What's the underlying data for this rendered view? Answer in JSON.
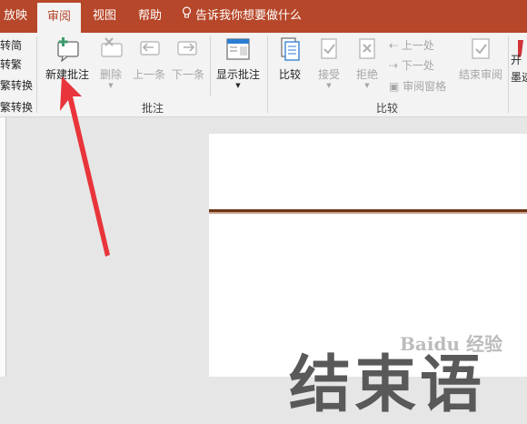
{
  "tabs": [
    {
      "label": "放映",
      "active": false
    },
    {
      "label": "审阅",
      "active": true
    },
    {
      "label": "视图",
      "active": false
    },
    {
      "label": "帮助",
      "active": false
    }
  ],
  "tell_me": "告诉我你想要做什么",
  "chinese_conversion": [
    "转简",
    "转繁",
    "繁转换",
    "繁转换"
  ],
  "comments_group": {
    "label": "批注",
    "new_comment": "新建批注",
    "delete": "删除",
    "previous": "上一条",
    "next": "下一条",
    "show_comments": "显示批注"
  },
  "compare_group": {
    "label": "比较",
    "compare": "比较",
    "accept": "接受",
    "reject": "拒绝",
    "prev_change": "上一处",
    "next_change": "下一处",
    "reviewing_pane": "审阅窗格",
    "end_review": "结束审阅"
  },
  "ink_partial": [
    "开",
    "墨迹"
  ],
  "slide": {
    "big_text": "结束语"
  },
  "watermark": "Baidu 经验",
  "colors": {
    "accent": "#b7472a",
    "arrow": "#e8343a"
  }
}
